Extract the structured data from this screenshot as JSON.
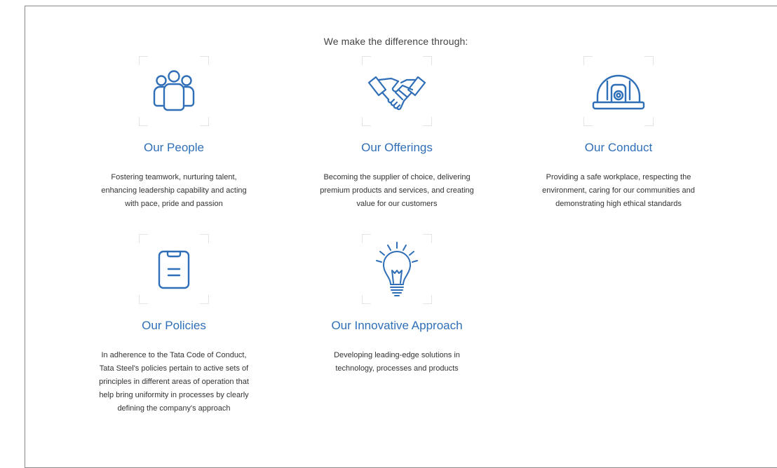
{
  "heading": "We make the difference through:",
  "accent_color": "#2f6fb8",
  "cards": [
    {
      "icon": "people-icon",
      "title": "Our People",
      "description_lines": [
        "Fostering teamwork, nurturing talent,",
        "enhancing leadership capability and acting",
        "with pace, pride and passion"
      ]
    },
    {
      "icon": "handshake-icon",
      "title": "Our Offerings",
      "description_lines": [
        "Becoming the supplier of choice, delivering",
        "premium products and services, and creating",
        "value for our customers"
      ]
    },
    {
      "icon": "safety-helmet-icon",
      "title": "Our Conduct",
      "description_lines": [
        "Providing a safe workplace, respecting the",
        "environment, caring for our communities and",
        "demonstrating high ethical standards"
      ]
    },
    {
      "icon": "clipboard-icon",
      "title": "Our Policies",
      "description_lines": [
        "In adherence to the Tata Code of Conduct,",
        "Tata Steel's policies pertain to active sets of",
        "principles in different areas of operation that",
        "help bring uniformity in processes by clearly",
        "defining the company's approach"
      ]
    },
    {
      "icon": "lightbulb-icon",
      "title": "Our Innovative Approach",
      "description_lines": [
        "Developing leading-edge solutions in",
        "technology, processes and products"
      ]
    }
  ]
}
